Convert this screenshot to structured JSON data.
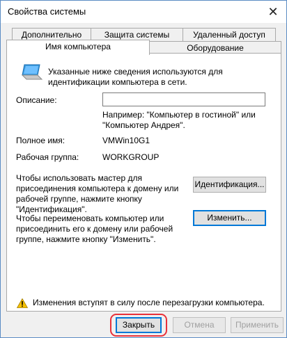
{
  "window": {
    "title": "Свойства системы",
    "close_glyph": "✕"
  },
  "tabs": {
    "row1": [
      "Дополнительно",
      "Защита системы",
      "Удаленный доступ"
    ],
    "row2": [
      "Имя компьютера",
      "Оборудование"
    ]
  },
  "content": {
    "intro": "Указанные ниже сведения используются для идентификации компьютера в сети.",
    "description_label": "Описание:",
    "description_value": "",
    "example": "Например: \"Компьютер в гостиной\" или \"Компьютер Андрея\".",
    "fullname_label": "Полное имя:",
    "fullname_value": "VMWin10G1",
    "workgroup_label": "Рабочая группа:",
    "workgroup_value": "WORKGROUP",
    "wizard_text": "Чтобы использовать мастер для присоединения компьютера к домену или рабочей группе, нажмите кнопку \"Идентификация\".",
    "id_button": "Идентификация...",
    "rename_text": "Чтобы переименовать компьютер или присоединить его к домену или рабочей группе, нажмите кнопку \"Изменить\".",
    "change_button": "Изменить...",
    "warning": "Изменения вступят в силу после перезагрузки компьютера."
  },
  "footer": {
    "close": "Закрыть",
    "cancel": "Отмена",
    "apply": "Применить"
  },
  "colors": {
    "accent": "#0078d7",
    "highlight": "#e8313a",
    "warning": "#f5c000"
  },
  "icons": {
    "computer": "computer-icon",
    "warning": "warning-icon",
    "close": "close-icon"
  }
}
